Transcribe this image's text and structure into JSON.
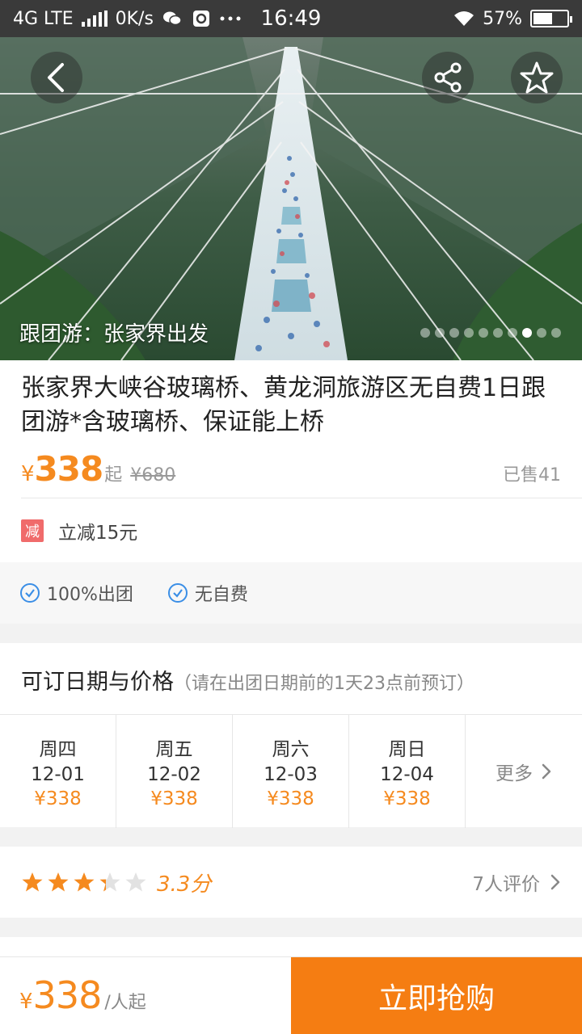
{
  "status_bar": {
    "network": "4G LTE",
    "speed": "0K/s",
    "time": "16:49",
    "battery": "57%",
    "battery_level": 0.57
  },
  "hero": {
    "caption": "跟团游：张家界出发",
    "slide_count": 10,
    "active_slide": 8
  },
  "product": {
    "title": "张家界大峡谷玻璃桥、黄龙洞旅游区无自费1日跟团游*含玻璃桥、保证能上桥",
    "currency": "¥",
    "price": "338",
    "price_suffix": "起",
    "original_price": "¥680",
    "sold": "已售41"
  },
  "promo": {
    "tag": "减",
    "text": "立减15元"
  },
  "features": [
    {
      "label": "100%出团"
    },
    {
      "label": "无自费"
    }
  ],
  "dates": {
    "title": "可订日期与价格",
    "note": "（请在出团日期前的1天23点前预订）",
    "items": [
      {
        "weekday": "周四",
        "date": "12-01",
        "price": "¥338"
      },
      {
        "weekday": "周五",
        "date": "12-02",
        "price": "¥338"
      },
      {
        "weekday": "周六",
        "date": "12-03",
        "price": "¥338"
      },
      {
        "weekday": "周日",
        "date": "12-04",
        "price": "¥338"
      }
    ],
    "more_label": "更多"
  },
  "rating": {
    "score": "3.3分",
    "stars": 3.3,
    "reviews": "7人评价"
  },
  "bottom_bar": {
    "currency": "¥",
    "price": "338",
    "per": "/人起",
    "buy_label": "立即抢购"
  },
  "colors": {
    "accent": "#f58a1f",
    "buy_button": "#f57d12",
    "promo_tag": "#f06b6b",
    "check": "#3a8ee6"
  }
}
